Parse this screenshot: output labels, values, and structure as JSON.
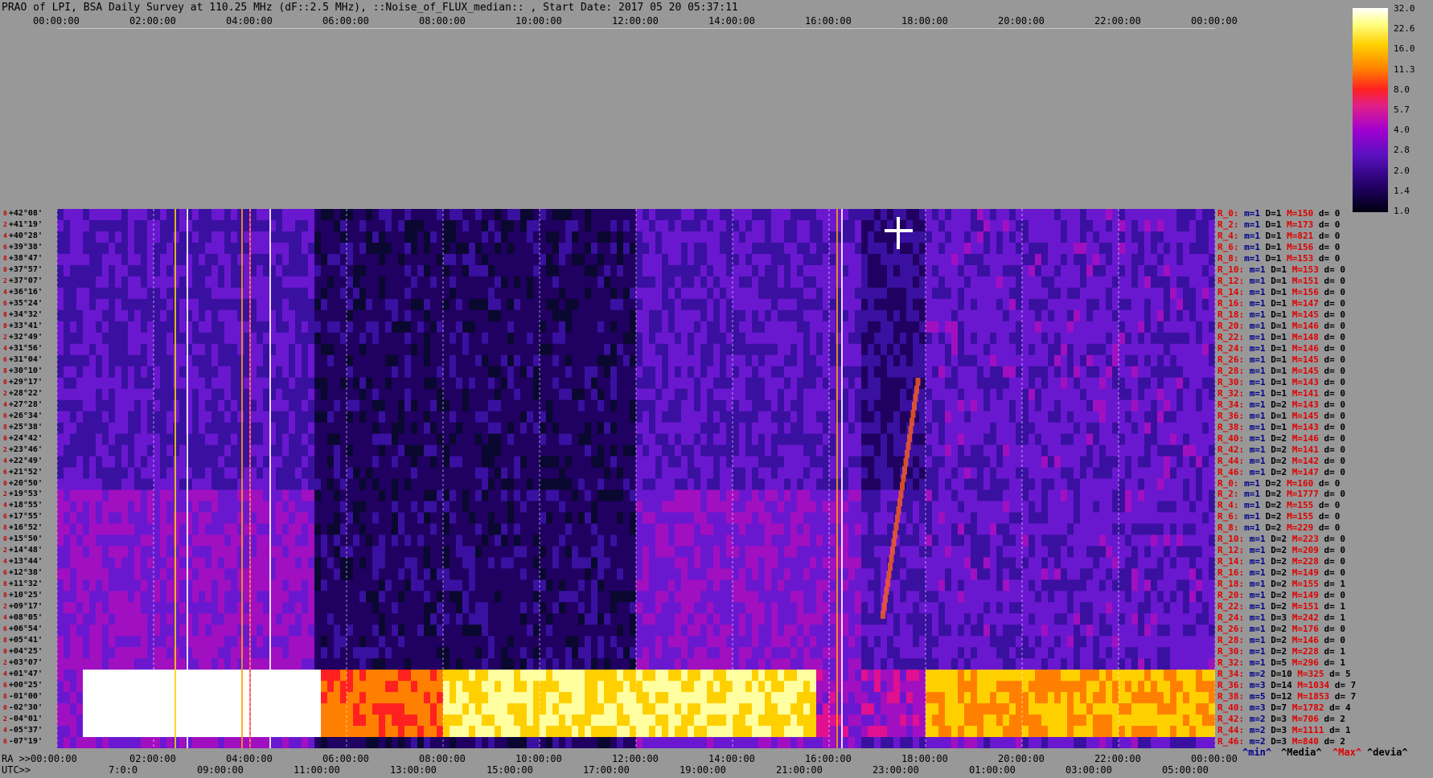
{
  "title": "PRAO of LPI, BSA Daily Survey at 110.25 MHz (dF::2.5 MHz), ::Noise_of_FLUX_median:: , Start Date: 2017 05 20 05:37:11",
  "top_axis": [
    "00:00:00",
    "02:00:00",
    "04:00:00",
    "06:00:00",
    "08:00:00",
    "10:00:00",
    "12:00:00",
    "14:00:00",
    "16:00:00",
    "18:00:00",
    "20:00:00",
    "22:00:00",
    "00:00:00"
  ],
  "ra_prefix": "RA >>",
  "ra_axis": [
    "00:00:00",
    "02:00:00",
    "04:00:00",
    "06:00:00",
    "08:00:00",
    "10:00:00",
    "12:00:00",
    "14:00:00",
    "16:00:00",
    "18:00:00",
    "20:00:00",
    "22:00:00",
    "00:00:00"
  ],
  "utc_prefix": "UTC>>",
  "utc_axis": [
    "7:0:0",
    "09:00:00",
    "11:00:00",
    "13:00:00",
    "15:00:00",
    "17:00:00",
    "19:00:00",
    "21:00:00",
    "23:00:00",
    "01:00:00",
    "03:00:00",
    "05:00:00"
  ],
  "colorbar_ticks": [
    "32.0",
    "22.6",
    "16.0",
    "11.3",
    "8.0",
    "5.7",
    "4.0",
    "2.8",
    "2.0",
    "1.4",
    "1.0"
  ],
  "legend": [
    {
      "text": "^min^",
      "color": "#00008a"
    },
    {
      "text": "^Media^",
      "color": "#000000"
    },
    {
      "text": "^Max^",
      "color": "#e00000"
    },
    {
      "text": "^devia^",
      "color": "#000000"
    }
  ],
  "chart_data": {
    "type": "heatmap",
    "title": "PRAO of LPI, BSA Daily Survey at 110.25 MHz (dF::2.5 MHz), ::Noise_of_FLUX_median:: , Start Date: 2017 05 20 05:37:11",
    "xlabel": "RA / UTC",
    "ylabel": "",
    "colorbar_range": [
      1.0,
      32.0
    ],
    "declinations": [
      "+42°08'",
      "+41°19'",
      "+40°28'",
      "+39°38'",
      "+38°47'",
      "+37°57'",
      "+37°07'",
      "+36°16'",
      "+35°24'",
      "+34°32'",
      "+33°41'",
      "+32°49'",
      "+31°56'",
      "+31°04'",
      "+30°10'",
      "+29°17'",
      "+28°22'",
      "+27°28'",
      "+26°34'",
      "+25°38'",
      "+24°42'",
      "+23°46'",
      "+22°49'",
      "+21°52'",
      "+20°50'",
      "+19°53'",
      "+18°55'",
      "+17°55'",
      "+16°52'",
      "+15°50'",
      "+14°48'",
      "+13°44'",
      "+12°38'",
      "+11°32'",
      "+10°25'",
      "+09°17'",
      "+08°05'",
      "+06°54'",
      "+05°41'",
      "+04°25'",
      "+03°07'",
      "+01°47'",
      "+00°25'",
      "-01°00'",
      "-02°30'",
      "-04°01'",
      "-05°37'",
      "-07°19'"
    ],
    "row_stats": [
      {
        "r": "R_0:",
        "min": "m=1",
        "d": "D=1",
        "max": "M=150",
        "dev": "d= 0"
      },
      {
        "r": "R_2:",
        "min": "m=1",
        "d": "D=1",
        "max": "M=173",
        "dev": "d= 0"
      },
      {
        "r": "R_4:",
        "min": "m=1",
        "d": "D=1",
        "max": "M=821",
        "dev": "d= 0"
      },
      {
        "r": "R_6:",
        "min": "m=1",
        "d": "D=1",
        "max": "M=156",
        "dev": "d= 0"
      },
      {
        "r": "R_8:",
        "min": "m=1",
        "d": "D=1",
        "max": "M=153",
        "dev": "d= 0"
      },
      {
        "r": "R_10:",
        "min": "m=1",
        "d": "D=1",
        "max": "M=153",
        "dev": "d= 0"
      },
      {
        "r": "R_12:",
        "min": "m=1",
        "d": "D=1",
        "max": "M=151",
        "dev": "d= 0"
      },
      {
        "r": "R_14:",
        "min": "m=1",
        "d": "D=1",
        "max": "M=156",
        "dev": "d= 0"
      },
      {
        "r": "R_16:",
        "min": "m=1",
        "d": "D=1",
        "max": "M=147",
        "dev": "d= 0"
      },
      {
        "r": "R_18:",
        "min": "m=1",
        "d": "D=1",
        "max": "M=145",
        "dev": "d= 0"
      },
      {
        "r": "R_20:",
        "min": "m=1",
        "d": "D=1",
        "max": "M=146",
        "dev": "d= 0"
      },
      {
        "r": "R_22:",
        "min": "m=1",
        "d": "D=1",
        "max": "M=148",
        "dev": "d= 0"
      },
      {
        "r": "R_24:",
        "min": "m=1",
        "d": "D=1",
        "max": "M=146",
        "dev": "d= 0"
      },
      {
        "r": "R_26:",
        "min": "m=1",
        "d": "D=1",
        "max": "M=145",
        "dev": "d= 0"
      },
      {
        "r": "R_28:",
        "min": "m=1",
        "d": "D=1",
        "max": "M=145",
        "dev": "d= 0"
      },
      {
        "r": "R_30:",
        "min": "m=1",
        "d": "D=1",
        "max": "M=143",
        "dev": "d= 0"
      },
      {
        "r": "R_32:",
        "min": "m=1",
        "d": "D=1",
        "max": "M=141",
        "dev": "d= 0"
      },
      {
        "r": "R_34:",
        "min": "m=1",
        "d": "D=2",
        "max": "M=143",
        "dev": "d= 0"
      },
      {
        "r": "R_36:",
        "min": "m=1",
        "d": "D=1",
        "max": "M=145",
        "dev": "d= 0"
      },
      {
        "r": "R_38:",
        "min": "m=1",
        "d": "D=1",
        "max": "M=143",
        "dev": "d= 0"
      },
      {
        "r": "R_40:",
        "min": "m=1",
        "d": "D=2",
        "max": "M=146",
        "dev": "d= 0"
      },
      {
        "r": "R_42:",
        "min": "m=1",
        "d": "D=2",
        "max": "M=141",
        "dev": "d= 0"
      },
      {
        "r": "R_44:",
        "min": "m=1",
        "d": "D=2",
        "max": "M=142",
        "dev": "d= 0"
      },
      {
        "r": "R_46:",
        "min": "m=1",
        "d": "D=2",
        "max": "M=147",
        "dev": "d= 0"
      },
      {
        "r": "R_0:",
        "min": "m=1",
        "d": "D=2",
        "max": "M=160",
        "dev": "d= 0"
      },
      {
        "r": "R_2:",
        "min": "m=1",
        "d": "D=2",
        "max": "M=1777",
        "dev": "d= 0"
      },
      {
        "r": "R_4:",
        "min": "m=1",
        "d": "D=2",
        "max": "M=155",
        "dev": "d= 0"
      },
      {
        "r": "R_6:",
        "min": "m=1",
        "d": "D=2",
        "max": "M=155",
        "dev": "d= 0"
      },
      {
        "r": "R_8:",
        "min": "m=1",
        "d": "D=2",
        "max": "M=229",
        "dev": "d= 0"
      },
      {
        "r": "R_10:",
        "min": "m=1",
        "d": "D=2",
        "max": "M=223",
        "dev": "d= 0"
      },
      {
        "r": "R_12:",
        "min": "m=1",
        "d": "D=2",
        "max": "M=209",
        "dev": "d= 0"
      },
      {
        "r": "R_14:",
        "min": "m=1",
        "d": "D=2",
        "max": "M=228",
        "dev": "d= 0"
      },
      {
        "r": "R_16:",
        "min": "m=1",
        "d": "D=2",
        "max": "M=149",
        "dev": "d= 0"
      },
      {
        "r": "R_18:",
        "min": "m=1",
        "d": "D=2",
        "max": "M=155",
        "dev": "d= 1"
      },
      {
        "r": "R_20:",
        "min": "m=1",
        "d": "D=2",
        "max": "M=149",
        "dev": "d= 0"
      },
      {
        "r": "R_22:",
        "min": "m=1",
        "d": "D=2",
        "max": "M=151",
        "dev": "d= 1"
      },
      {
        "r": "R_24:",
        "min": "m=1",
        "d": "D=3",
        "max": "M=242",
        "dev": "d= 1"
      },
      {
        "r": "R_26:",
        "min": "m=1",
        "d": "D=2",
        "max": "M=176",
        "dev": "d= 0"
      },
      {
        "r": "R_28:",
        "min": "m=1",
        "d": "D=2",
        "max": "M=146",
        "dev": "d= 0"
      },
      {
        "r": "R_30:",
        "min": "m=1",
        "d": "D=2",
        "max": "M=228",
        "dev": "d= 1"
      },
      {
        "r": "R_32:",
        "min": "m=1",
        "d": "D=5",
        "max": "M=296",
        "dev": "d= 1"
      },
      {
        "r": "R_34:",
        "min": "m=2",
        "d": "D=10",
        "max": "M=325",
        "dev": "d= 5"
      },
      {
        "r": "R_36:",
        "min": "m=3",
        "d": "D=14",
        "max": "M=1034",
        "dev": "d= 7"
      },
      {
        "r": "R_38:",
        "min": "m=5",
        "d": "D=12",
        "max": "M=1853",
        "dev": "d= 7"
      },
      {
        "r": "R_40:",
        "min": "m=3",
        "d": "D=7",
        "max": "M=1782",
        "dev": "d= 4"
      },
      {
        "r": "R_42:",
        "min": "m=2",
        "d": "D=3",
        "max": "M=706",
        "dev": "d= 2"
      },
      {
        "r": "R_44:",
        "min": "m=2",
        "d": "D=3",
        "max": "M=1111",
        "dev": "d= 1"
      },
      {
        "r": "R_46:",
        "min": "m=2",
        "d": "D=3",
        "max": "M=840",
        "dev": "d= 2"
      }
    ]
  }
}
